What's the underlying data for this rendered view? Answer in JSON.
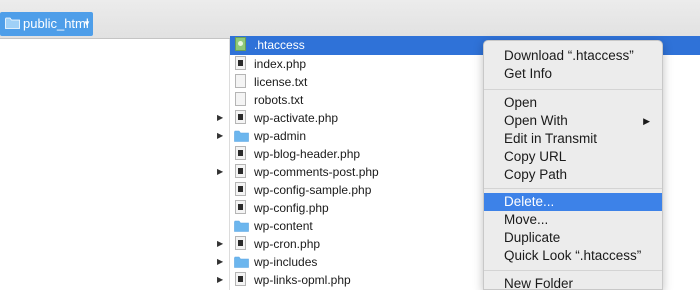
{
  "path_bar": {
    "folder_name": "public_html"
  },
  "files": [
    {
      "name": ".htaccess",
      "icon": "htaccess-file-icon",
      "kind": "green",
      "selected": true,
      "expandable": false
    },
    {
      "name": "index.php",
      "icon": "php-file-icon",
      "kind": "php",
      "selected": false,
      "expandable": false
    },
    {
      "name": "license.txt",
      "icon": "text-file-icon",
      "kind": "txt",
      "selected": false,
      "expandable": false
    },
    {
      "name": "robots.txt",
      "icon": "text-file-icon",
      "kind": "txt",
      "selected": false,
      "expandable": false
    },
    {
      "name": "wp-activate.php",
      "icon": "php-file-icon",
      "kind": "php",
      "selected": false,
      "expandable": true
    },
    {
      "name": "wp-admin",
      "icon": "folder-icon",
      "kind": "folder",
      "selected": false,
      "expandable": true
    },
    {
      "name": "wp-blog-header.php",
      "icon": "php-file-icon",
      "kind": "php",
      "selected": false,
      "expandable": false
    },
    {
      "name": "wp-comments-post.php",
      "icon": "php-file-icon",
      "kind": "php",
      "selected": false,
      "expandable": true
    },
    {
      "name": "wp-config-sample.php",
      "icon": "php-file-icon",
      "kind": "php",
      "selected": false,
      "expandable": false
    },
    {
      "name": "wp-config.php",
      "icon": "php-file-icon",
      "kind": "php",
      "selected": false,
      "expandable": false
    },
    {
      "name": "wp-content",
      "icon": "folder-icon",
      "kind": "folder",
      "selected": false,
      "expandable": false
    },
    {
      "name": "wp-cron.php",
      "icon": "php-file-icon",
      "kind": "php",
      "selected": false,
      "expandable": true
    },
    {
      "name": "wp-includes",
      "icon": "folder-icon",
      "kind": "folder",
      "selected": false,
      "expandable": true
    },
    {
      "name": "wp-links-opml.php",
      "icon": "php-file-icon",
      "kind": "php",
      "selected": false,
      "expandable": true
    }
  ],
  "context_menu": {
    "download": "Download “.htaccess”",
    "get_info": "Get Info",
    "open": "Open",
    "open_with": "Open With",
    "edit_in_transmit": "Edit in Transmit",
    "copy_url": "Copy URL",
    "copy_path": "Copy Path",
    "delete": "Delete...",
    "move": "Move...",
    "duplicate": "Duplicate",
    "quick_look": "Quick Look “.htaccess”",
    "new_folder": "New Folder",
    "highlighted_item": "Delete..."
  },
  "colors": {
    "path_chip": "#4e9ee9",
    "row_selection": "#2f72d8",
    "menu_highlight": "#3d82e8",
    "folder": "#6cb6ee"
  }
}
